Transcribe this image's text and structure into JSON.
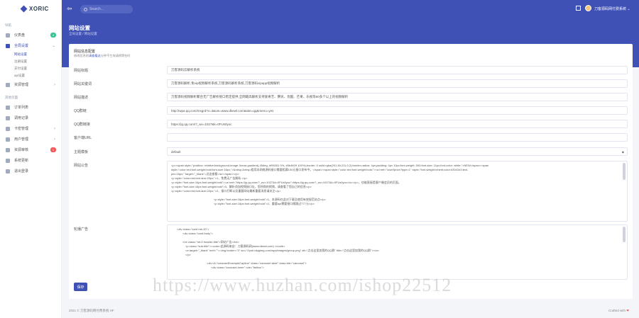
{
  "app": {
    "logo": "XORIC"
  },
  "sidebar": {
    "section1": "导航",
    "section2": "其他页面",
    "items": [
      {
        "label": "仪表盘",
        "icon": "dashboard-icon",
        "badge": "4"
      },
      {
        "label": "全局设置",
        "icon": "settings-icon"
      },
      {
        "label": "资源管理",
        "icon": "folder-icon"
      },
      {
        "label": "订单列表",
        "icon": "order-icon"
      },
      {
        "label": "调用记录",
        "icon": "record-icon"
      },
      {
        "label": "卡密管理",
        "icon": "card-icon"
      },
      {
        "label": "用户管理",
        "icon": "user-icon"
      },
      {
        "label": "资源审核",
        "icon": "audit-icon",
        "badge": "1"
      },
      {
        "label": "系统更新",
        "icon": "update-icon"
      },
      {
        "label": "退出登录",
        "icon": "logout-icon"
      }
    ],
    "sub_items": [
      "网站设置",
      "注册设置",
      "支付设置",
      "api设置"
    ]
  },
  "topbar": {
    "search_placeholder": "Search...",
    "user": "刀客源码网付费系统"
  },
  "page": {
    "title": "网站设置",
    "breadcrumb": "全局设置 / 网站设置"
  },
  "card": {
    "title": "网站信息配置",
    "desc_prefix": "修改信息前",
    "desc_link": "请查看这",
    "desc_suffix": "分钟不生效请稍等些时"
  },
  "form": {
    "site_title_label": "网站标题",
    "site_title_value": "刀客源码云解析系统",
    "keywords_label": "网站关键词",
    "keywords_value": "刀客源码解析,免vip视频解析系统,刀客源码解析系统,刀客源码vipapp视频解析",
    "desc_label": "网站描述",
    "desc_value": "刀客源码视频解析聚合无广告解析接口稳定提供,全网最高解析支持爱奇艺、腾讯、优酷、芒果、乐视等60多个以上的视频解析",
    "qq_label": "QQ群链",
    "qq_value": "http://wpa.qq.com/msgrd?v=3&uin=www.dkewl.com&site=qq&menu=yes",
    "qqgroup_label": "QQ群链接",
    "qqgroup_value": "https://jq.qq.com/?_wv=1027&k=0FUs0yoc",
    "cs_label": "客户端URL",
    "cs_value": "",
    "theme_label": "主题模板",
    "theme_value": "default",
    "notice_label": "网站公告",
    "notice_lines": [
      "<p><span style=\"position: relative;background-image: linear-gradient(-45deg, #f95261 0%, #0b4609 100%);border: 0 solid rgba(201,84,211,0.2);border-radius: 4px;padding: 4px 10px;font-weight: 500;font-size: 11px;font-color: white;\">NEW</span><span",
      "style=\"color:red;font-weight:bold;font-size:16px;\">&nbsp;&nbsp;租用本网络源码接口需要相满100元接口发布中。</span><span style=\"color:red;font-weight:bold;\"><a href=\"/user/price?type=1\" style=\"font-weight:inherit;color:#3041b3;text-",
      "pec:16px;\" target=\"_blank\">点这查看</a></span></p>",
      "<p style=\"color:red;font-size:20px;\">1、免费无广告解析.</p>",
      "<p style=\"font-size:16px;font-weight:bold\"><a href=\"https://jq.qq.com/?_wv=1027&k=0FUs0yoc\">https://jq.qq.com/?_wv=1027&k=0FUs0yoc</a></p>，也能直接是客户端会员的页面。",
      "<p style=\"font-size:16px;font-weight:bold\">3、解析须加视频接口址，您所购的视频，请查看了您自己的信息</p>",
      "<p style=\"color:red;font-size:22px;\">2、接口打断以及重要网站最新重要消息请关注</p>",
      "",
      "<p style=\"font-size:16px;font-weight:bold\">1、本源码在此对下载及使用有效规范站点</p>",
      "<p style=\"font-size:16px;font-weight:bold\">2、重要api需要接口随跳过777元</p>"
    ],
    "ad_label": "轮播广告",
    "ad_lines": [
      "<div class=\"card mb-20\">",
      "    <div class=\"card-body\">",
      "",
      "<h4 class=\"mt-0 header-title\">网站广告</h4>",
      "    <p class=\"sub-title\"><code>此源码来自：刀客源码网(www.dkewl.com) </code>",
      "    <a target=\"_blank\" href=\"\"><img border=\"0\" src=\"//pub.idqqimg.com/wpa/images/group.png\" alt=\"点击这里加我的QQ群\" title=\"点击这里加我的QQ群\"></a>",
      "    </p>",
      "",
      "        <div id=\"carouselExampleCaption\" class=\"carousel slide\" data-ride=\"carousel\">",
      "            <div class=\"carousel-inner\" role=\"listbox\">"
    ],
    "save_label": "保存"
  },
  "footer": {
    "left": "2021 © 刀客源码网付费系统 HF",
    "right": "Crafted with"
  },
  "watermark": "https://www.huzhan.com/ishop22512",
  "colors": {
    "primary": "#3f51b5",
    "green_badge": "#3ec396",
    "red_badge": "#f05a5a"
  }
}
